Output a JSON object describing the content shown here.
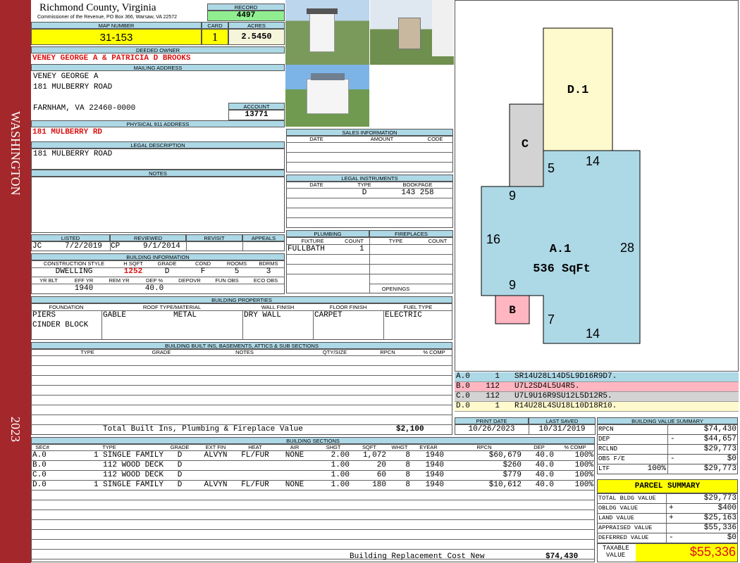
{
  "band": {
    "district": "WASHINGTON",
    "year": "2023"
  },
  "header": {
    "county": "Richmond County, Virginia",
    "address": "Commissioner of the Revenue, PO Box 366, Warsaw, VA 22572",
    "record_label": "RECORD",
    "record": "4497",
    "map_label": "MAP NUMBER",
    "map": "31-153",
    "card_label": "CARD",
    "card": "1",
    "acres_label": "ACRES",
    "acres": "2.5450"
  },
  "owner": {
    "label": "DEEDED OWNER",
    "name": "VENEY GEORGE A & PATRICIA D BROOKS",
    "mail_label": "MAILING ADDRESS",
    "mail1": "VENEY GEORGE A",
    "mail2": "181 MULBERRY ROAD",
    "mail3": "FARNHAM, VA 22460-0000",
    "account_label": "ACCOUNT",
    "account": "13771",
    "addr911_label": "PHYSICAL 911 ADDRESS",
    "addr911": "181 MULBERRY RD",
    "legal_label": "LEGAL DESCRIPTION",
    "legal": "181 MULBERRY ROAD",
    "notes_label": "NOTES"
  },
  "sales": {
    "label": "SALES INFORMATION",
    "cols": [
      "DATE",
      "AMOUNT",
      "CODE"
    ]
  },
  "legal_inst": {
    "label": "LEGAL INSTRUMENTS",
    "cols": [
      "DATE",
      "TYPE",
      "BOOKPAGE"
    ],
    "type": "D",
    "bookpage": "143 258"
  },
  "review": {
    "cols": [
      "LISTED",
      "REVIEWED",
      "REVISIT",
      "APPEALS"
    ],
    "listed_by": "JC",
    "listed": "7/2/2019",
    "reviewed_by": "CP",
    "reviewed": "9/1/2014"
  },
  "building_info": {
    "label": "BUILDING INFORMATION",
    "cols": [
      "CONSTRUCTION STYLE",
      "H SQFT",
      "GRADE",
      "COND",
      "ROOMS",
      "BDRMS"
    ],
    "style": "DWELLING",
    "hsqft": "1252",
    "grade": "D",
    "cond": "F",
    "rooms": "5",
    "bdrms": "3",
    "cols2": [
      "YR BLT",
      "EFF YR",
      "REM YR",
      "DEP %",
      "DEPOVR",
      "FUN OBS",
      "ECO OBS"
    ],
    "eff_yr": "1940",
    "dep": "40.0"
  },
  "plumbing": {
    "label": "PLUMBING",
    "cols": [
      "FIXTURE",
      "COUNT"
    ],
    "fixture": "FULLBATH",
    "count": "1"
  },
  "fireplaces": {
    "label": "FIREPLACES",
    "cols": [
      "TYPE",
      "COUNT"
    ],
    "openings": "OPENINGS"
  },
  "properties": {
    "label": "BUILDING PROPERTIES",
    "cols": [
      "FOUNDATION",
      "ROOF TYPE/MATERIAL",
      "WALL FINISH",
      "FLOOR FINISH",
      "FUEL TYPE"
    ],
    "foundation1": "PIERS",
    "foundation2": "CINDER BLOCK",
    "roof_type": "GABLE",
    "roof_mat": "METAL",
    "wall": "DRY WALL",
    "floor": "CARPET",
    "fuel": "ELECTRIC"
  },
  "builtins": {
    "label": "BUILDING BUILT INS, BASEMENTS, ATTICS & SUB SECTIONS",
    "cols": [
      "TYPE",
      "GRADE",
      "NOTES",
      "QTY/SIZE",
      "RPCN",
      "% COMP"
    ],
    "total_label": "Total Built Ins, Plumbing & Fireplace Value",
    "total": "$2,100"
  },
  "dates": {
    "print_label": "PRINT DATE",
    "print": "10/26/2023",
    "saved_label": "LAST SAVED",
    "saved": "10/31/2019"
  },
  "sections": {
    "label": "BUILDING SECTIONS",
    "cols": [
      "SEC#",
      "TYPE",
      "GRADE",
      "EXT FIN",
      "HEAT",
      "AIR",
      "SHGT",
      "SQFT",
      "WHGT",
      "EYEAR",
      "RPCN",
      "DEP",
      "% COMP"
    ],
    "rows": [
      [
        "A.0",
        "1 SINGLE FAMILY",
        "D",
        "ALVYN",
        "FL/FUR",
        "NONE",
        "2.00",
        "1,072",
        "8",
        "1940",
        "$60,679",
        "40.0",
        "100%"
      ],
      [
        "B.0",
        "112 WOOD DECK",
        "D",
        "",
        "",
        "",
        "1.00",
        "20",
        "8",
        "1940",
        "$260",
        "40.0",
        "100%"
      ],
      [
        "C.0",
        "112 WOOD DECK",
        "D",
        "",
        "",
        "",
        "1.00",
        "60",
        "8",
        "1940",
        "$779",
        "40.0",
        "100%"
      ],
      [
        "D.0",
        "1 SINGLE FAMILY",
        "D",
        "ALVYN",
        "FL/FUR",
        "NONE",
        "1.00",
        "180",
        "8",
        "1940",
        "$10,612",
        "40.0",
        "100%"
      ]
    ],
    "rcn_label": "Building Replacement Cost New",
    "rcn": "$74,430"
  },
  "sketch": {
    "labels": [
      "D.1",
      "C",
      "A.1",
      "536 SqFt",
      "B"
    ],
    "dims": [
      "14",
      "5",
      "9",
      "16",
      "28",
      "9",
      "7",
      "14"
    ],
    "legend": [
      {
        "code": "A.0",
        "num": "1",
        "path": "SR14U28L14D5L9D16R9D7.",
        "color": "#add8e6"
      },
      {
        "code": "B.0",
        "num": "112",
        "path": "U7L2SD4L5U4R5.",
        "color": "#ffb6c1"
      },
      {
        "code": "C.0",
        "num": "112",
        "path": "U7L9U16R9SU12L5D12R5.",
        "color": "#d3d3d3"
      },
      {
        "code": "D.0",
        "num": "1",
        "path": "R14U28L4SU18L10D18R10.",
        "color": "#fffacd"
      }
    ]
  },
  "bvs": {
    "label": "BUILDING VALUE SUMMARY",
    "rows": [
      {
        "k": "RPCN",
        "s": "",
        "v": "$74,430"
      },
      {
        "k": "DEP",
        "s": "-",
        "v": "$44,657"
      },
      {
        "k": "RCLND",
        "s": "",
        "v": "$29,773"
      },
      {
        "k": "OBS F/E",
        "s": "-",
        "v": "$0"
      },
      {
        "k": "LTF",
        "p": "100%",
        "s": "",
        "v": "$29,773"
      }
    ]
  },
  "parcel": {
    "label": "PARCEL SUMMARY",
    "rows": [
      {
        "k": "TOTAL BLDG VALUE",
        "s": "",
        "v": "$29,773"
      },
      {
        "k": "OBLDG VALUE",
        "s": "+",
        "v": "$400"
      },
      {
        "k": "LAND VALUE",
        "s": "+",
        "v": "$25,163"
      },
      {
        "k": "APPRAISED VALUE",
        "s": "",
        "v": "$55,336"
      },
      {
        "k": "DEFERRED VALUE",
        "s": "-",
        "v": "$0"
      }
    ],
    "taxable_label1": "TAXABLE",
    "taxable_label2": "VALUE",
    "taxable": "$55,336"
  }
}
